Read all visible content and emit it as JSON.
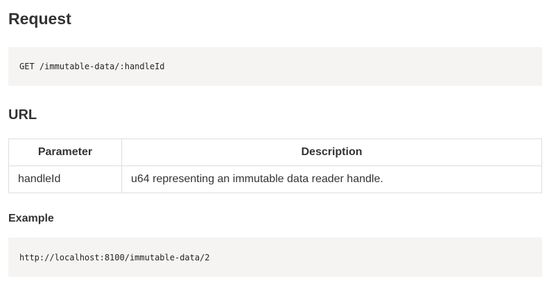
{
  "request": {
    "heading": "Request",
    "code": "GET /immutable-data/:handleId"
  },
  "url": {
    "heading": "URL",
    "table": {
      "headers": [
        "Parameter",
        "Description"
      ],
      "rows": [
        [
          "handleId",
          "u64 representing an immutable data reader handle."
        ]
      ]
    }
  },
  "example": {
    "heading": "Example",
    "code": "http://localhost:8100/immutable-data/2"
  }
}
